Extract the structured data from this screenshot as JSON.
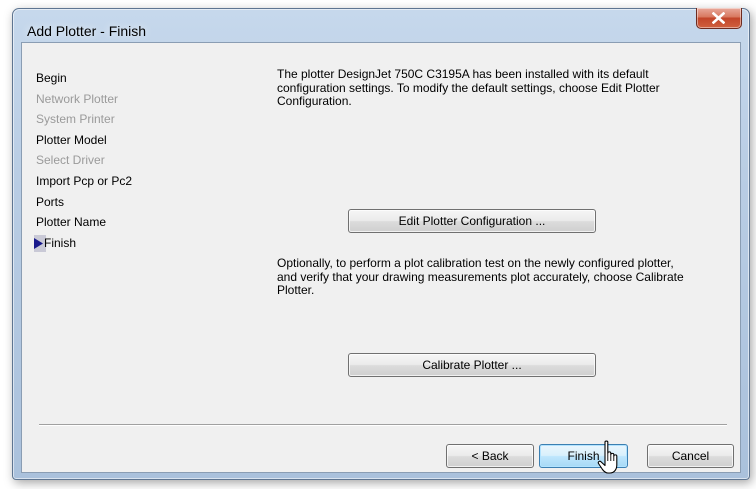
{
  "window": {
    "title": "Add Plotter - Finish"
  },
  "steps": [
    {
      "label": "Begin",
      "state": "active"
    },
    {
      "label": "Network Plotter",
      "state": "inactive"
    },
    {
      "label": "System Printer",
      "state": "inactive"
    },
    {
      "label": "Plotter Model",
      "state": "active"
    },
    {
      "label": "Select Driver",
      "state": "inactive"
    },
    {
      "label": "Import Pcp or Pc2",
      "state": "active"
    },
    {
      "label": "Ports",
      "state": "active"
    },
    {
      "label": "Plotter Name",
      "state": "active"
    },
    {
      "label": "Finish",
      "state": "current"
    }
  ],
  "content": {
    "intro": "The plotter DesignJet 750C C3195A has been installed with its default configuration settings.  To modify the default settings, choose Edit Plotter Configuration.",
    "edit_button": "Edit Plotter Configuration ...",
    "calibration_text": "Optionally, to perform a plot calibration test on the newly configured plotter, and verify that your drawing measurements plot accurately, choose Calibrate Plotter.",
    "calibrate_button": "Calibrate Plotter ..."
  },
  "footer": {
    "back_label": "< Back",
    "finish_label": "Finish",
    "cancel_label": "Cancel"
  },
  "colors": {
    "close_button": "#c7472a",
    "default_button_border": "#3c7fb1",
    "inactive_step": "#9a9a9a",
    "current_marker": "#1a1a8c"
  },
  "icons": {
    "close": "close-icon",
    "current_step": "arrow-right-icon",
    "mouse": "mouse-cursor-icon"
  }
}
